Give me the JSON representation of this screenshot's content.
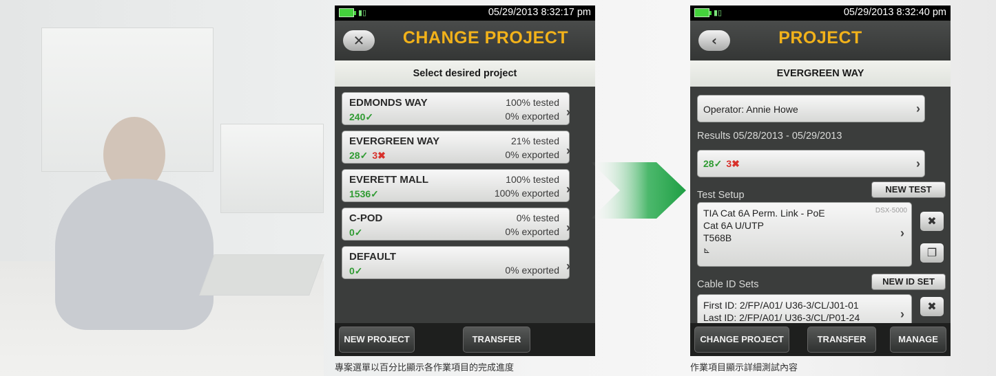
{
  "left_screen": {
    "status_time": "05/29/2013 8:32:17 pm",
    "title": "CHANGE PROJECT",
    "subheader": "Select desired project",
    "projects": [
      {
        "name": "EDMONDS WAY",
        "tested": "100% tested",
        "exported": "0% exported",
        "pass": "240",
        "fail": ""
      },
      {
        "name": "EVERGREEN WAY",
        "tested": "21% tested",
        "exported": "0% exported",
        "pass": "28",
        "fail": "3"
      },
      {
        "name": "EVERETT MALL",
        "tested": "100% tested",
        "exported": "100% exported",
        "pass": "1536",
        "fail": ""
      },
      {
        "name": "C-POD",
        "tested": "0% tested",
        "exported": "0% exported",
        "pass": "0",
        "fail": ""
      },
      {
        "name": "DEFAULT",
        "tested": "",
        "exported": "0% exported",
        "pass": "0",
        "fail": ""
      }
    ],
    "buttons": {
      "new_project": "NEW PROJECT",
      "transfer": "TRANSFER"
    },
    "caption": "專案選單以百分比顯示各作業項目的完成進度"
  },
  "right_screen": {
    "status_time": "05/29/2013 8:32:40 pm",
    "title": "PROJECT",
    "subheader": "EVERGREEN WAY",
    "operator": "Operator: Annie Howe",
    "results_label": "Results 05/28/2013 - 05/29/2013",
    "results": {
      "pass": "28",
      "fail": "3"
    },
    "test_setup_label": "Test Setup",
    "new_test": "NEW TEST",
    "setup": {
      "line1": "TIA Cat 6A Perm. Link - PoE",
      "line2": "Cat 6A U/UTP",
      "line3": "T568B",
      "device": "DSX-5000"
    },
    "cable_id_label": "Cable ID Sets",
    "new_id_set": "NEW ID SET",
    "first_id": "First ID: 2/FP/A01/ U36-3/CL/J01-01",
    "last_id": "Last ID: 2/FP/A01/ U36-3/CL/P01-24",
    "buttons": {
      "change_project": "CHANGE PROJECT",
      "transfer": "TRANSFER",
      "manage": "MANAGE"
    },
    "caption": "作業項目顯示詳細測試內容"
  },
  "glyphs": {
    "check": "✓",
    "cross": "✖",
    "chevron": "›",
    "back": "‹",
    "close": "✕"
  },
  "colors": {
    "title_gold": "#f2b21a",
    "pass_green": "#2f9b32",
    "fail_red": "#d8312b",
    "arrow_green": "#22a94a"
  }
}
